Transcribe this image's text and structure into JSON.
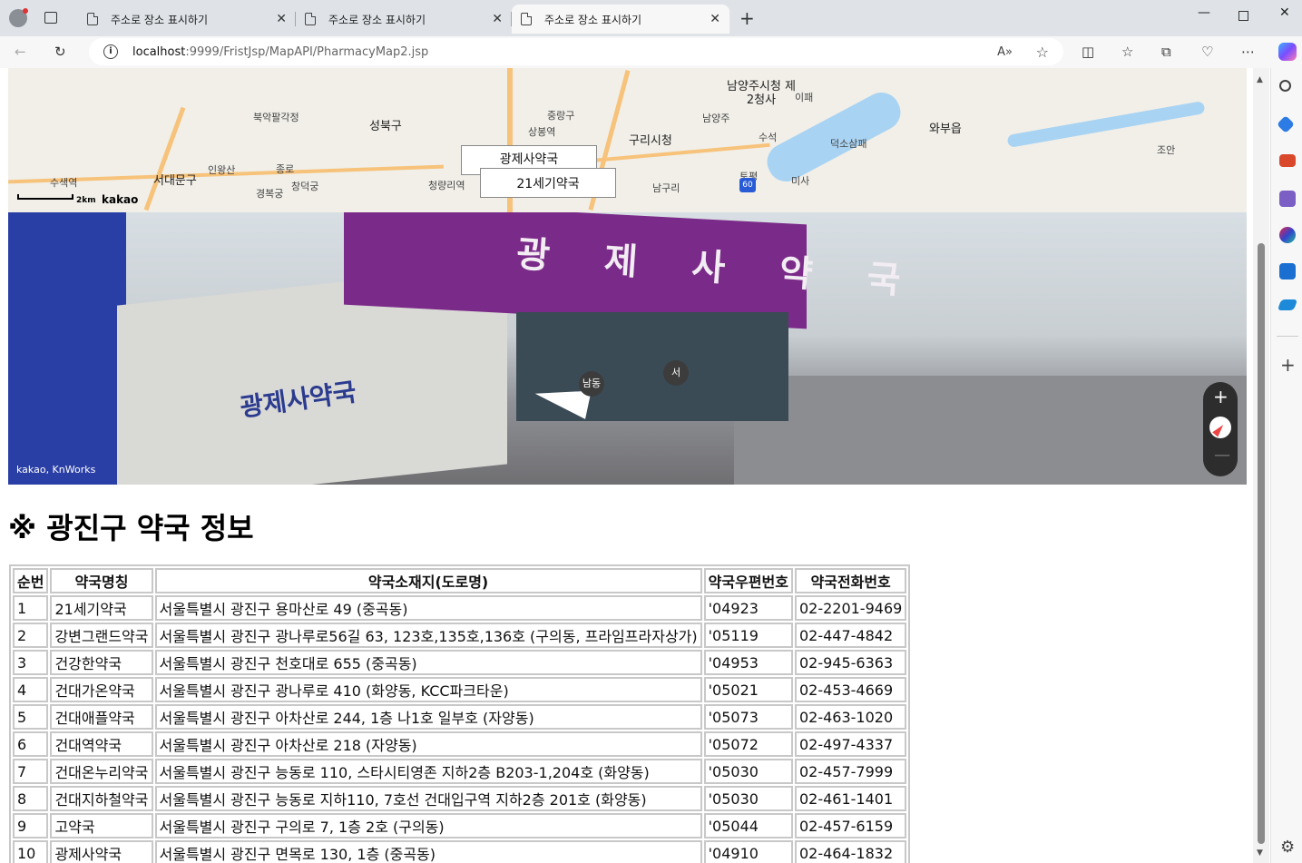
{
  "browser": {
    "tabs": [
      {
        "title": "주소로 장소 표시하기"
      },
      {
        "title": "주소로 장소 표시하기"
      },
      {
        "title": "주소로 장소 표시하기"
      }
    ],
    "address_host": "localhost",
    "address_path": ":9999/FristJsp/MapAPI/PharmacyMap2.jsp"
  },
  "map": {
    "labels": [
      "북악팔각정",
      "성북구",
      "중랑구",
      "상봉역",
      "남양주시청 제2청사",
      "구리시청",
      "와부읍",
      "인왕산",
      "종로",
      "서대문구",
      "창덕궁",
      "경복궁",
      "청량리역",
      "수색역",
      "남양주",
      "수석",
      "덕소삼패",
      "토평",
      "남구리",
      "미사",
      "조안",
      "이패"
    ],
    "markers": [
      "광제사약국",
      "21세기약국"
    ],
    "scale_label": "2km",
    "brand": "kakao"
  },
  "roadview": {
    "sign_text": "광제사약국",
    "wall_text": "광제사약국",
    "nodes": [
      "남동",
      "서"
    ],
    "credit": "kakao, KnWorks"
  },
  "heading": "※ 광진구 약국 정보",
  "table": {
    "headers": [
      "순번",
      "약국명칭",
      "약국소재지(도로명)",
      "약국우편번호",
      "약국전화번호"
    ],
    "rows": [
      [
        "1",
        "21세기약국",
        "서울특별시 광진구 용마산로 49 (중곡동)",
        "'04923",
        "02-2201-9469"
      ],
      [
        "2",
        "강변그랜드약국",
        "서울특별시 광진구 광나루로56길 63, 123호,135호,136호 (구의동, 프라임프라자상가)",
        "'05119",
        "02-447-4842"
      ],
      [
        "3",
        "건강한약국",
        "서울특별시 광진구 천호대로 655 (중곡동)",
        "'04953",
        "02-945-6363"
      ],
      [
        "4",
        "건대가온약국",
        "서울특별시 광진구 광나루로 410 (화양동, KCC파크타운)",
        "'05021",
        "02-453-4669"
      ],
      [
        "5",
        "건대애플약국",
        "서울특별시 광진구 아차산로 244, 1층 나1호 일부호 (자양동)",
        "'05073",
        "02-463-1020"
      ],
      [
        "6",
        "건대역약국",
        "서울특별시 광진구 아차산로 218 (자양동)",
        "'05072",
        "02-497-4337"
      ],
      [
        "7",
        "건대온누리약국",
        "서울특별시 광진구 능동로 110, 스타시티영존 지하2층 B203-1,204호 (화양동)",
        "'05030",
        "02-457-7999"
      ],
      [
        "8",
        "건대지하철약국",
        "서울특별시 광진구 능동로 지하110, 7호선 건대입구역 지하2층 201호 (화양동)",
        "'05030",
        "02-461-1401"
      ],
      [
        "9",
        "고약국",
        "서울특별시 광진구 구의로 7, 1층 2호 (구의동)",
        "'05044",
        "02-457-6159"
      ],
      [
        "10",
        "광제사약국",
        "서울특별시 광진구 면목로 130, 1층 (중곡동)",
        "'04910",
        "02-464-1832"
      ]
    ]
  }
}
